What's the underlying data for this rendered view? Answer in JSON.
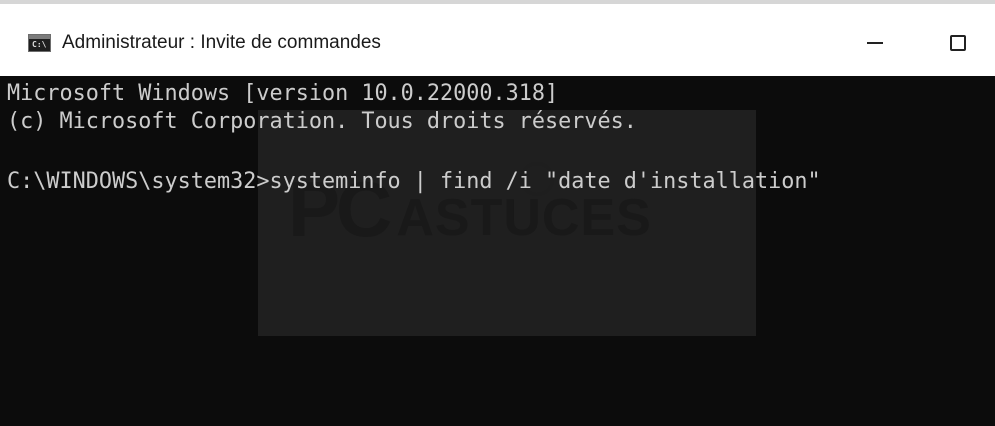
{
  "window": {
    "title": "Administrateur : Invite de commandes",
    "icon": "cmd-icon",
    "icon_prompt_text": "C:\\",
    "controls": {
      "minimize_icon": "minimize-icon",
      "maximize_icon": "maximize-icon"
    }
  },
  "console": {
    "lines": [
      "Microsoft Windows [version 10.0.22000.318]",
      "(c) Microsoft Corporation. Tous droits réservés.",
      "C:\\WINDOWS\\system32>systeminfo | find /i \"date d'installation\""
    ]
  },
  "watermark": {
    "brand_part1": "PC",
    "brand_part2": "ASTUCES"
  },
  "colors": {
    "console_background": "#0c0c0c",
    "console_text": "#cccccc",
    "titlebar_background": "#ffffff"
  }
}
